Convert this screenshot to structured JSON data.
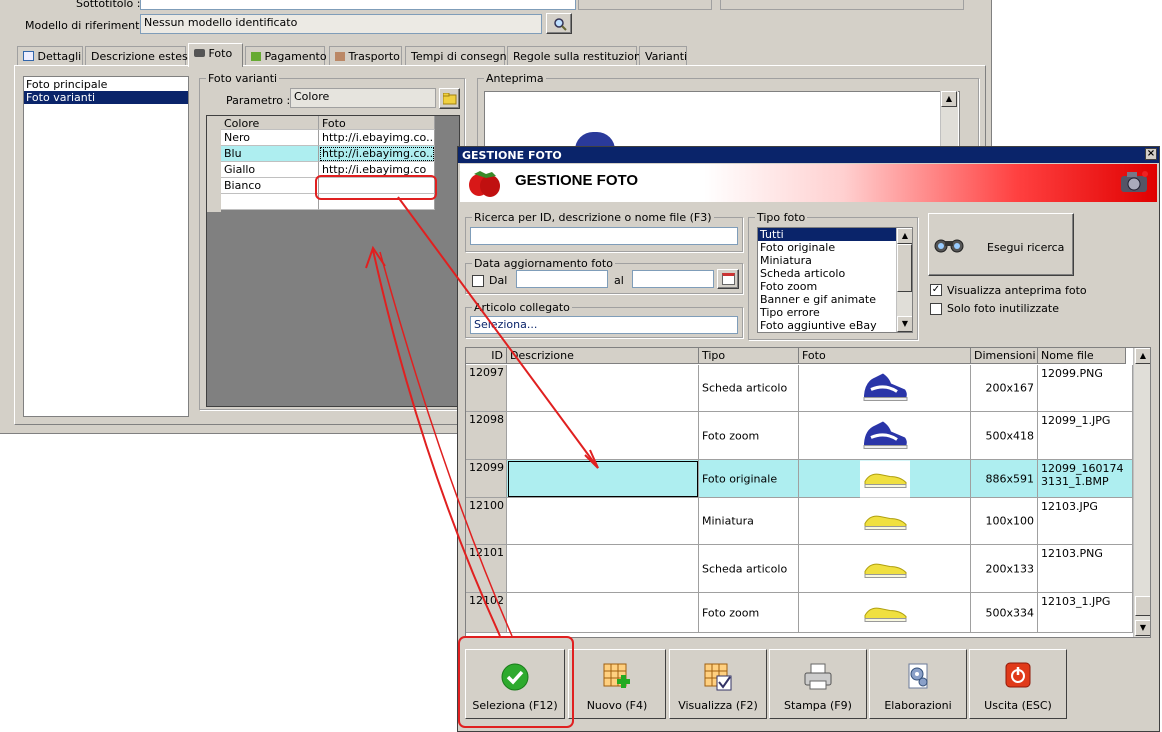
{
  "bg": {
    "sottotitolo_label": "Sottotitolo :",
    "modello_label": "Modello di riferimento :",
    "modello_value": "Nessun modello identificato",
    "tabs": [
      "Dettagli",
      "Descrizione estesa",
      "Foto",
      "Pagamento",
      "Trasporto",
      "Tempi di consegna",
      "Regole sulla restituzione",
      "Varianti"
    ],
    "photo_list": [
      "Foto principale",
      "Foto varianti"
    ],
    "foto_varianti_group": "Foto varianti",
    "parametro_label": "Parametro :",
    "parametro_value": "Colore",
    "grid_headers": [
      "Colore",
      "Foto"
    ],
    "grid_rows": [
      {
        "colore": "Nero",
        "foto": "http://i.ebayimg.co..."
      },
      {
        "colore": "Blu",
        "foto": "http://i.ebayimg.co..."
      },
      {
        "colore": "Giallo",
        "foto": "http://i.ebayimg.co"
      },
      {
        "colore": "Bianco",
        "foto": ""
      }
    ],
    "anteprima_group": "Anteprima"
  },
  "dialog": {
    "title": "GESTIONE FOTO",
    "header": "GESTIONE FOTO",
    "search_group": "Ricerca per ID, descrizione o nome file (F3)",
    "date_group": "Data aggiornamento foto",
    "dal_label": "Dal",
    "al_label": "al",
    "articolo_group": "Articolo collegato",
    "articolo_value": "Seleziona...",
    "tipo_group": "Tipo foto",
    "tipo_items": [
      "Tutti",
      "Foto originale",
      "Miniatura",
      "Scheda articolo",
      "Foto zoom",
      "Banner e gif animate",
      "Tipo errore",
      "Foto aggiuntive eBay"
    ],
    "search_button": "Esegui ricerca",
    "chk_anteprima": "Visualizza anteprima foto",
    "chk_inutilizzate": "Solo foto inutilizzate",
    "table_headers": [
      "ID",
      "Descrizione",
      "Tipo",
      "Foto",
      "Dimensioni",
      "Nome file"
    ],
    "rows": [
      {
        "id": "12097",
        "descrizione": "",
        "tipo": "Scheda articolo",
        "dim": "200x167",
        "file": "12099.PNG",
        "shoe": "blue"
      },
      {
        "id": "12098",
        "descrizione": "",
        "tipo": "Foto zoom",
        "dim": "500x418",
        "file": "12099_1.JPG",
        "shoe": "blue"
      },
      {
        "id": "12099",
        "descrizione": "",
        "tipo": "Foto originale",
        "dim": "886x591",
        "file": "12099_1601743131_1.BMP",
        "shoe": "yellow"
      },
      {
        "id": "12100",
        "descrizione": "",
        "tipo": "Miniatura",
        "dim": "100x100",
        "file": "12103.JPG",
        "shoe": "yellow"
      },
      {
        "id": "12101",
        "descrizione": "",
        "tipo": "Scheda articolo",
        "dim": "200x133",
        "file": "12103.PNG",
        "shoe": "yellow"
      },
      {
        "id": "12102",
        "descrizione": "",
        "tipo": "Foto zoom",
        "dim": "500x334",
        "file": "12103_1.JPG",
        "shoe": "yellow"
      }
    ],
    "buttons": {
      "seleziona": "Seleziona (F12)",
      "nuovo": "Nuovo (F4)",
      "visualizza": "Visualizza (F2)",
      "stampa": "Stampa (F9)",
      "elaborazioni": "Elaborazioni",
      "uscita": "Uscita (ESC)"
    }
  },
  "colors": {
    "highlight_red": "#e02020",
    "selection_cyan": "#aeeef0",
    "title_blue": "#0a246a"
  }
}
